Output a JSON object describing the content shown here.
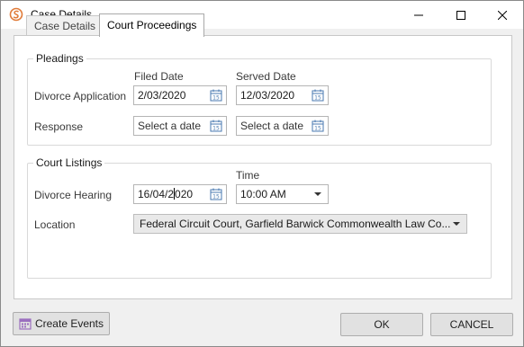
{
  "window": {
    "title": "Case Details"
  },
  "tabs": [
    {
      "label": "Case Details"
    },
    {
      "label": "Court Proceedings"
    }
  ],
  "pleadings": {
    "title": "Pleadings",
    "filed_header": "Filed Date",
    "served_header": "Served Date",
    "divorce_label": "Divorce Application",
    "divorce_filed": "2/03/2020",
    "divorce_served": "12/03/2020",
    "response_label": "Response",
    "response_filed_placeholder": "Select a date",
    "response_served_placeholder": "Select a date"
  },
  "listings": {
    "title": "Court Listings",
    "time_header": "Time",
    "hearing_label": "Divorce Hearing",
    "hearing_date_before": "16/04/2",
    "hearing_date_after": "020",
    "hearing_time": "10:00 AM",
    "location_label": "Location",
    "location_value": "Federal Circuit Court, Garfield Barwick Commonwealth Law Co..."
  },
  "footer": {
    "create_events_label": "Create Events",
    "ok_label": "OK",
    "cancel_label": "CANCEL"
  },
  "colors": {
    "app_icon": "#e07b39",
    "calendar_icon": "#4a7ab0",
    "create_icon": "#9b6fbf"
  }
}
